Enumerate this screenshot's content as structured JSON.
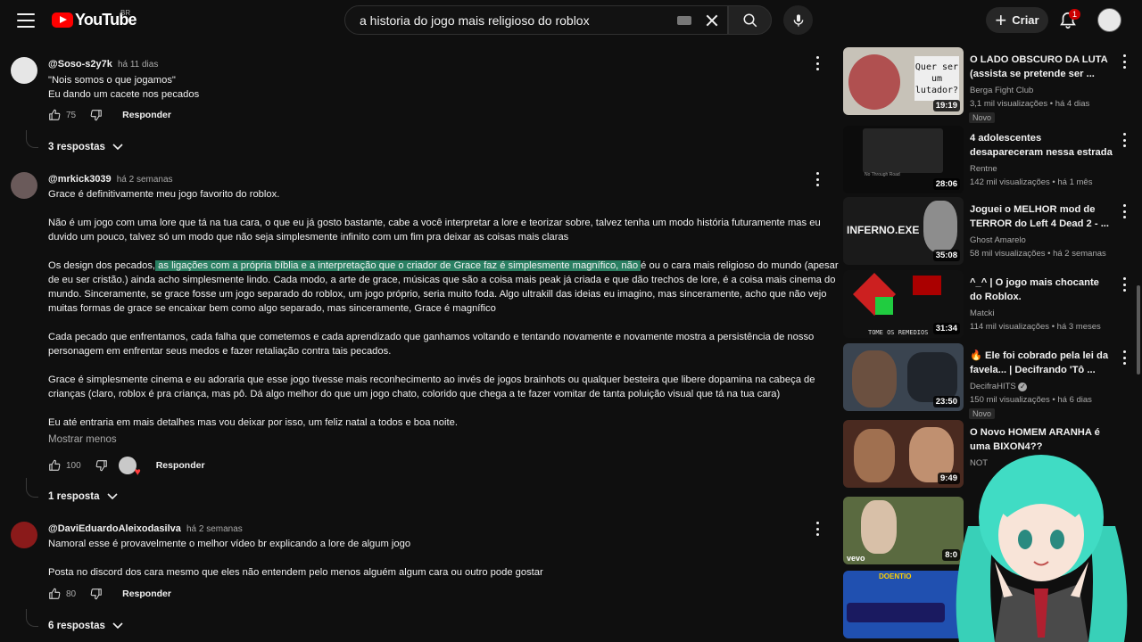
{
  "header": {
    "logo_text": "YouTube",
    "country": "BR",
    "search_value": "a historia do jogo mais religioso do roblox",
    "create_label": "Criar",
    "notification_count": "1"
  },
  "comments": [
    {
      "author": "@Soso-s2y7k",
      "time": "há 11 dias",
      "lines": [
        "\"Nois somos o que jogamos\"",
        "Eu dando um cacete nos pecados"
      ],
      "likes": "75",
      "reply_label": "Responder",
      "replies": "3 respostas"
    },
    {
      "author": "@mrkick3039",
      "time": "há 2 semanas",
      "p1": "Grace é definitivamente meu jogo favorito do roblox.",
      "p2a": "Não é um jogo com uma lore que tá na tua cara, o que eu já gosto bastante, cabe a você interpretar a lore e teorizar sobre, talvez tenha um modo história futuramente mas eu",
      "p2b": "duvido um pouco, talvez só um modo que não seja simplesmente infinito com um fim pra deixar as coisas mais claras",
      "p3a_pre": "Os design dos pecados,",
      "p3a_hl": " as ligações com a própria bíblia e a interpretação que o criador de Grace faz é simplesmente magnífico, não ",
      "p3a_post": "é ou o cara mais religioso do mundo (apesar",
      "p3b": "de eu ser cristão.) ainda acho simplesmente lindo. Cada modo, a arte de grace, músicas que são a coisa mais peak já criada e que dão trechos de lore, é a coisa mais cinema do",
      "p3c": "mundo. Sinceramente, se grace fosse um jogo separado do roblox, um jogo próprio, seria muito foda. Algo ultrakill das ideias eu imagino, mas sinceramente, acho que não vejo",
      "p3d": "muitas formas de grace se encaixar bem como algo separado, mas sinceramente, Grace é magnífico",
      "p4a": "Cada pecado que enfrentamos, cada falha que cometemos e cada aprendizado que ganhamos voltando e tentando novamente e novamente mostra a persistência de nosso",
      "p4b": "personagem em enfrentar seus medos e fazer retaliação contra tais pecados.",
      "p5a": "Grace é simplesmente cinema e eu adoraria que esse jogo tivesse mais reconhecimento ao invés de jogos brainhots ou qualquer besteira que libere dopamina na cabeça de",
      "p5b": "crianças (claro, roblox é pra criança, mas pô. Dá algo melhor do que um jogo chato, colorido que chega a te fazer vomitar de tanta poluição visual que tá na tua cara)",
      "p6": "Eu até entraria em mais detalhes mas vou deixar por isso, um feliz natal a todos e boa noite.",
      "show_less": "Mostrar menos",
      "likes": "100",
      "reply_label": "Responder",
      "replies": "1 resposta"
    },
    {
      "author": "@DaviEduardoAleixodasilva",
      "time": "há 2 semanas",
      "lines": [
        "Namoral esse é provavelmente o melhor vídeo br explicando a lore de algum jogo",
        "",
        "Posta no discord dos cara mesmo que eles não entendem pelo menos alguém algum cara ou outro pode gostar"
      ],
      "likes": "80",
      "reply_label": "Responder",
      "replies": "6 respostas"
    }
  ],
  "sidebar": [
    {
      "title": "O LADO OBSCURO DA LUTA (assista se pretende ser ...",
      "channel": "Berga Fight Club",
      "meta": "3,1 mil visualizações • há 4 dias",
      "badge": "Novo",
      "duration": "19:19",
      "thumb_text": "Quer ser um lutador?"
    },
    {
      "title": "4 adolescentes desapareceram nessa estrada",
      "channel": "Rentne",
      "meta": "142 mil visualizações • há 1 mês",
      "duration": "28:06",
      "thumb_text": "No Through Road"
    },
    {
      "title": "Joguei o MELHOR mod de TERROR do Left 4 Dead 2 - ...",
      "channel": "Ghost Amarelo",
      "meta": "58 mil visualizações • há 2 semanas",
      "duration": "35:08",
      "thumb_text": "INFERNO.EXE"
    },
    {
      "title": "^_^ | O jogo mais chocante do Roblox.",
      "channel": "Matcki",
      "meta": "114 mil visualizações • há 3 meses",
      "duration": "31:34",
      "thumb_text": "TOME OS REMEDIOS"
    },
    {
      "title": "🔥 Ele foi cobrado pela lei da favela... | Decifrando 'Tô ...",
      "channel": "DecifraHITS",
      "meta": "150 mil visualizações • há 6 dias",
      "badge": "Novo",
      "duration": "23:50"
    },
    {
      "title": "O Novo HOMEM ARANHA é uma BIXON4??",
      "channel": "NOT",
      "duration": "9:49"
    },
    {
      "duration": "8:0",
      "thumb_text": "vevo"
    },
    {
      "thumb_text": "DOENTIO"
    }
  ]
}
